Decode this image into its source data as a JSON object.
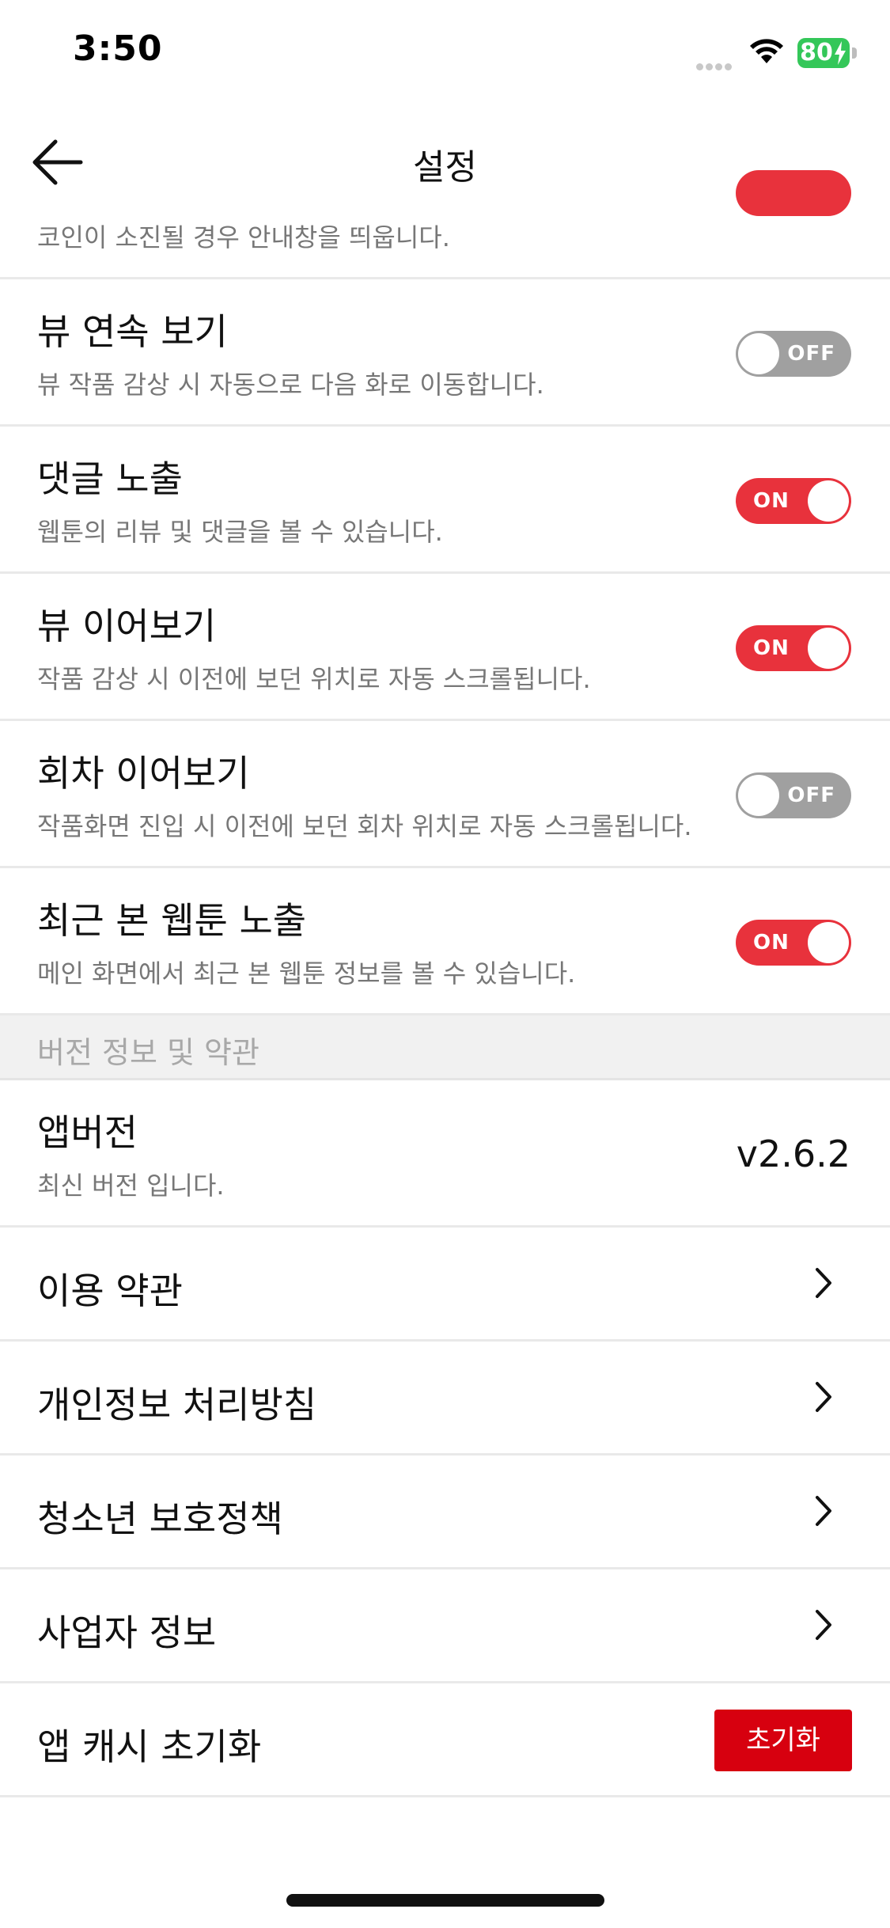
{
  "status_bar": {
    "time": "3:50",
    "battery": "80"
  },
  "nav": {
    "title": "설정",
    "back_icon": "arrow-left-icon"
  },
  "rows": [
    {
      "description": "코인이 소진될 경우 안내창을 띄웁니다.",
      "toggle_on": true
    },
    {
      "title": "뷰 연속 보기",
      "description": "뷰 작품 감상 시 자동으로 다음 화로 이동합니다.",
      "toggle_on": false,
      "toggle_label": "OFF"
    },
    {
      "title": "댓글 노출",
      "description": "웹툰의 리뷰 및 댓글을 볼 수 있습니다.",
      "toggle_on": true,
      "toggle_label": "ON"
    },
    {
      "title": "뷰 이어보기",
      "description": "작품 감상 시 이전에 보던 위치로 자동 스크롤됩니다.",
      "toggle_on": true,
      "toggle_label": "ON"
    },
    {
      "title": "회차 이어보기",
      "description": "작품화면 진입 시 이전에 보던 회차 위치로 자동 스크롤됩니다.",
      "toggle_on": false,
      "toggle_label": "OFF"
    },
    {
      "title": "최근 본 웹툰 노출",
      "description": "메인 화면에서 최근 본 웹툰 정보를 볼 수 있습니다.",
      "toggle_on": true,
      "toggle_label": "ON"
    }
  ],
  "section": {
    "title": "버전 정보 및 약관",
    "version": {
      "title": "앱버전",
      "description": "최신 버전 입니다.",
      "value": "v2.6.2"
    },
    "links": [
      {
        "label": "이용 약관",
        "icon": "chevron-right-icon"
      },
      {
        "label": "개인정보 처리방침",
        "icon": "chevron-right-icon"
      },
      {
        "label": "청소년 보호정책",
        "icon": "chevron-right-icon"
      },
      {
        "label": "사업자 정보",
        "icon": "chevron-right-icon"
      }
    ],
    "reset": {
      "label": "앱 캐시 초기화",
      "button": "초기화"
    }
  },
  "colors": {
    "accent": "#e8323c",
    "toggle_off": "#a0a0a0",
    "reset_button": "#d7000f",
    "battery": "#34c759"
  }
}
